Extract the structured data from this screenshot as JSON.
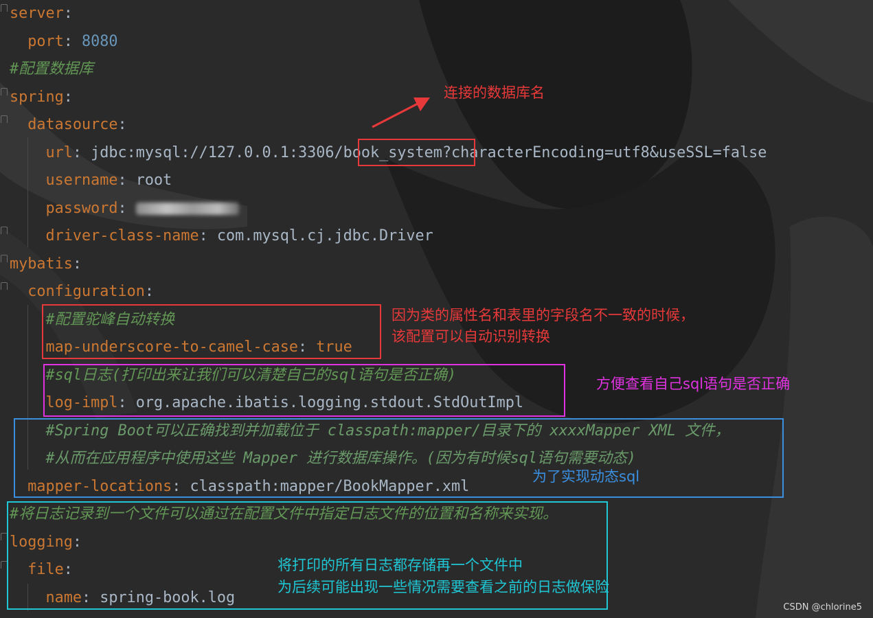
{
  "editor": {
    "lines": [
      {
        "k": "server"
      },
      {
        "k": "port",
        "v": "8080",
        "vt": "num"
      },
      {
        "c": "#配置数据库"
      },
      {
        "k": "spring"
      },
      {
        "k": "datasource"
      },
      {
        "k": "url",
        "v_pre": "jdbc:mysql://127.0.0.1:3306/",
        "v_box": "book_system",
        "v_post": "?characterEncoding=utf8&useSSL=false"
      },
      {
        "k": "username",
        "v": "root"
      },
      {
        "k": "password",
        "v": ""
      },
      {
        "k": "driver-class-name",
        "v": "com.mysql.cj.jdbc.Driver"
      },
      {
        "k": "mybatis"
      },
      {
        "k": "configuration"
      },
      {
        "c": "#配置驼峰自动转换"
      },
      {
        "k": "map-underscore-to-camel-case",
        "v": "true",
        "vt": "key"
      },
      {
        "c": "#sql日志(打印出来让我们可以清楚自己的sql语句是否正确)"
      },
      {
        "k": "log-impl",
        "v": "org.apache.ibatis.logging.stdout.StdOutImpl"
      },
      {
        "c": "#Spring Boot可以正确找到并加载位于 classpath:mapper/目录下的 xxxxMapper XML 文件，"
      },
      {
        "c": "#从而在应用程序中使用这些 Mapper 进行数据库操作。(因为有时候sql语句需要动态)"
      },
      {
        "k": "mapper-locations",
        "v": "classpath:mapper/BookMapper.xml"
      },
      {
        "c": "#将日志记录到一个文件可以通过在配置文件中指定日志文件的位置和名称来实现。"
      },
      {
        "k": "logging"
      },
      {
        "k": "file"
      },
      {
        "k": "name",
        "v": "spring-book.log"
      }
    ]
  },
  "annotations": {
    "db_name": "连接的数据库名",
    "camel_1": "因为类的属性名和表里的字段名不一致的时候，",
    "camel_2": "该配置可以自动识别转换",
    "sql_log": "方便查看自己sql语句是否正确",
    "mapper": "为了实现动态sql",
    "log_1": "将打印的所有日志都存储再一个文件中",
    "log_2": "为后续可能出现一些情况需要查看之前的日志做保险"
  },
  "watermark": "CSDN @chlorine5",
  "colors": {
    "red": "#e8393a",
    "magenta": "#e032e0",
    "blue": "#3a8fe0",
    "cyan": "#1fc7d4"
  }
}
